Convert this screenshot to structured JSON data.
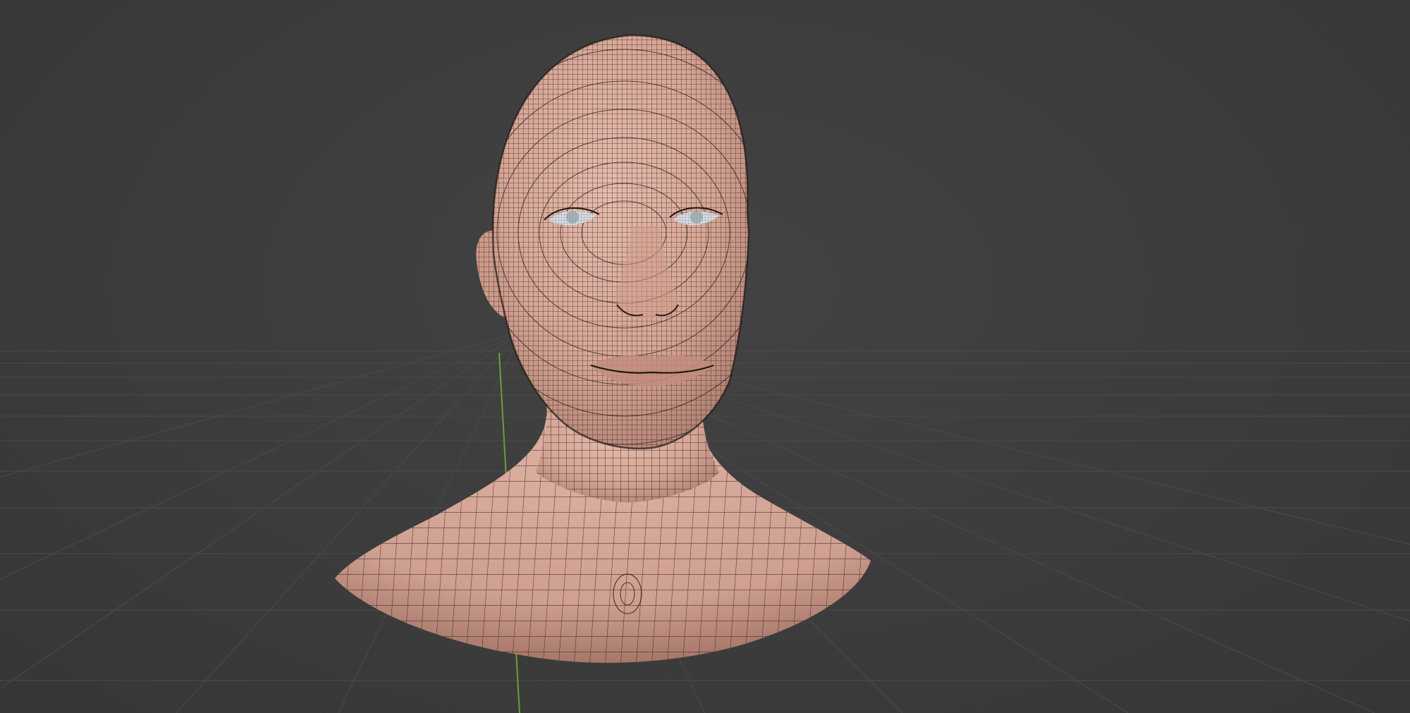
{
  "viewport": {
    "mode": "3d-viewport",
    "shading": "solid-with-wireframe-overlay",
    "background_color": "#3d3d3d",
    "grid_color": "#4d4d4d",
    "y_axis_color": "#6e9a3c"
  },
  "model": {
    "subject": "human-head-and-shoulders-bust",
    "skin_color": "#d9aa9a",
    "skin_shadow_color": "#a87a6c",
    "wire_color": "#2a1d1a",
    "eye_color": "#d7dde2"
  }
}
